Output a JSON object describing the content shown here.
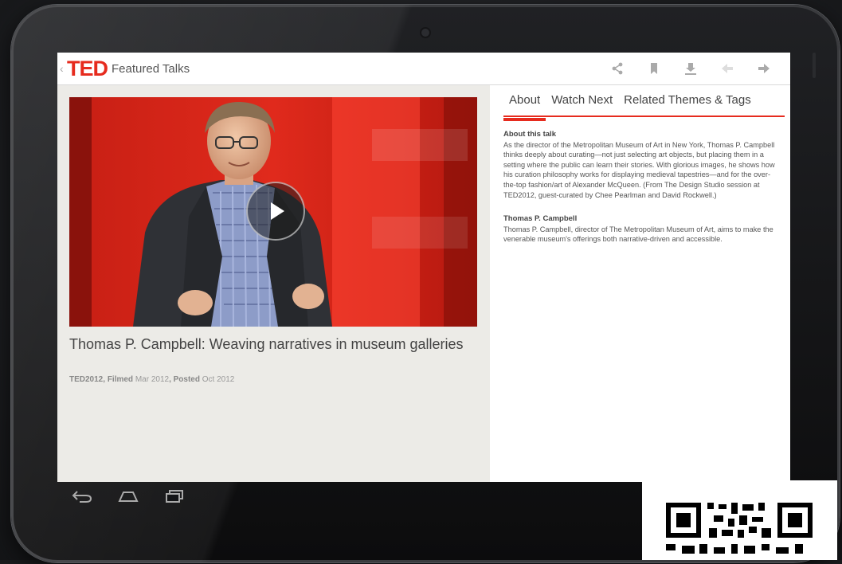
{
  "app": {
    "back_glyph": "‹",
    "logo": "TED",
    "title": "Featured Talks"
  },
  "actions": [
    {
      "icon": "share-icon"
    },
    {
      "icon": "bookmark-icon"
    },
    {
      "icon": "download-icon"
    },
    {
      "icon": "previous-icon"
    },
    {
      "icon": "next-icon"
    }
  ],
  "talk": {
    "title": "Thomas P. Campbell: Weaving narratives in museum galleries",
    "event": "TED2012",
    "filmed_label": "Filmed",
    "filmed": "Mar 2012",
    "posted_label": "Posted",
    "posted": "Oct 2012"
  },
  "tabs": [
    {
      "label": "About"
    },
    {
      "label": "Watch Next"
    },
    {
      "label": "Related Themes & Tags"
    }
  ],
  "about": {
    "heading": "About this talk",
    "body": "As the director of the Metropolitan Museum of Art in New York, Thomas P. Campbell thinks deeply about curating—not just selecting art objects, but placing them in a setting where the public can learn their stories. With glorious images, he shows how his curation philosophy works for displaying medieval tapestries—and for the over-the-top fashion/art of Alexander McQueen. (From The Design Studio session at TED2012, guest-curated by Chee Pearlman and David Rockwell.)",
    "speaker_heading": "Thomas P. Campbell",
    "speaker_body": "Thomas P. Campbell, director of The Metropolitan Museum of Art, aims to make the venerable museum's offerings both narrative-driven and accessible."
  },
  "system_nav": [
    {
      "icon": "back-icon"
    },
    {
      "icon": "home-icon"
    },
    {
      "icon": "recent-apps-icon"
    }
  ],
  "colors": {
    "accent": "#e62b1e",
    "pane_bg": "#ecebe7",
    "text": "#444444"
  }
}
